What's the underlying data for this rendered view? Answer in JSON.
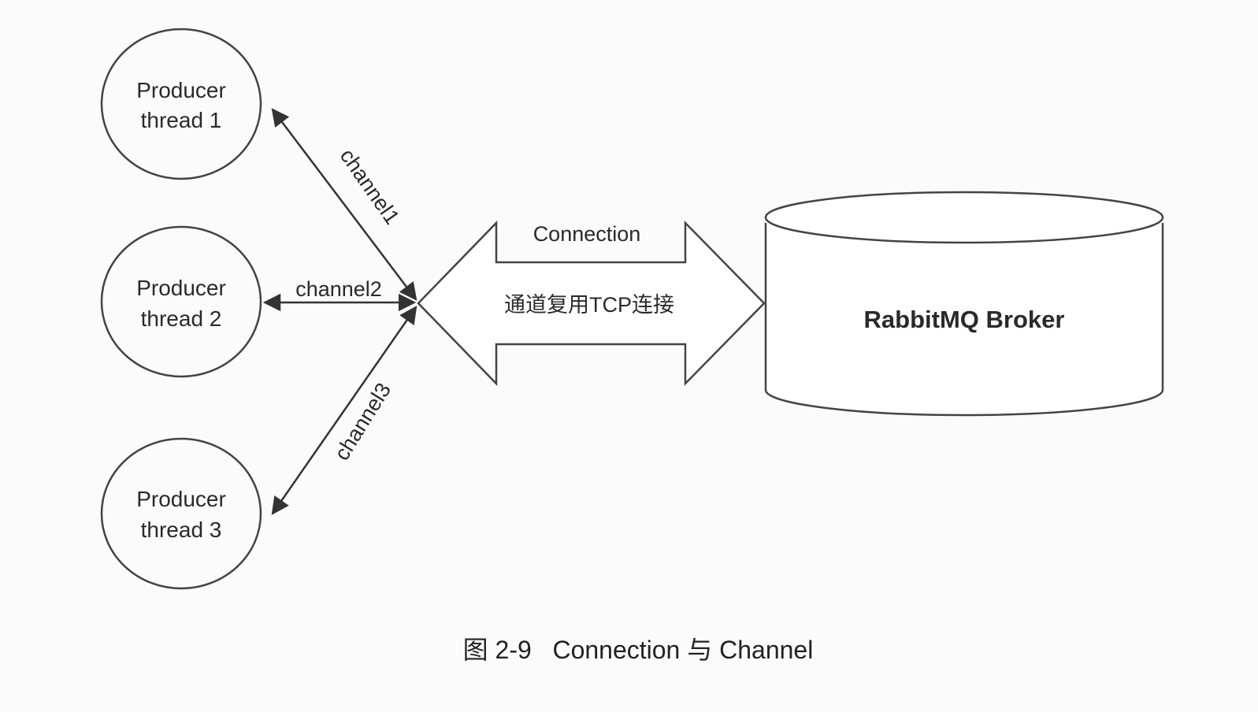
{
  "producers": [
    {
      "line1": "Producer",
      "line2": "thread 1"
    },
    {
      "line1": "Producer",
      "line2": "thread 2"
    },
    {
      "line1": "Producer",
      "line2": "thread 3"
    }
  ],
  "channels": [
    "channel1",
    "channel2",
    "channel3"
  ],
  "connection": {
    "label": "Connection",
    "sublabel": "通道复用TCP连接"
  },
  "broker": {
    "label": "RabbitMQ Broker"
  },
  "caption": "图 2-9   Connection 与 Channel"
}
